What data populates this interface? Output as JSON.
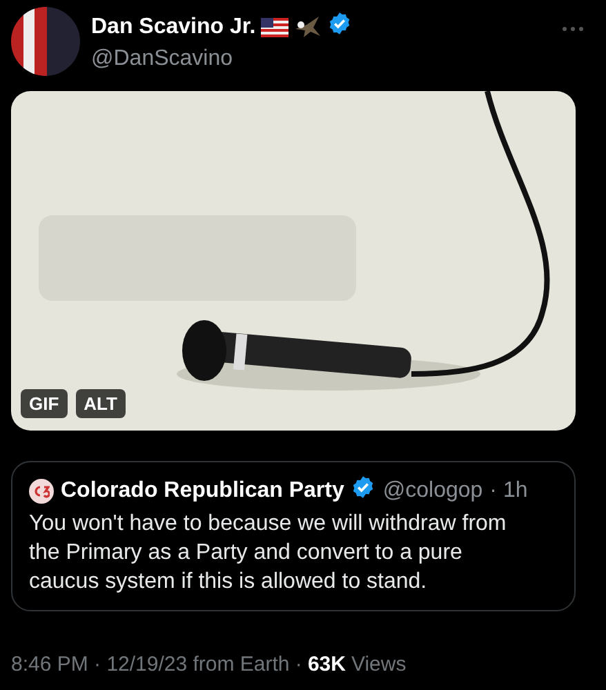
{
  "author": {
    "name": "Dan Scavino Jr.",
    "handle": "@DanScavino",
    "verified": true
  },
  "media": {
    "kind": "picture",
    "badges": [
      "GIF",
      "ALT"
    ]
  },
  "quote": {
    "name": "Colorado Republican Party",
    "verified": true,
    "handle": "@cologop",
    "time": "· 1h",
    "text": "You won't have to because we will withdraw from the Primary as a Party and convert to a pure caucus system if this is allowed to stand."
  },
  "footer": {
    "timestamp": "8:46 PM · 12/19/23 from Earth ·",
    "views_count": "63K",
    "views_label": "Views"
  }
}
